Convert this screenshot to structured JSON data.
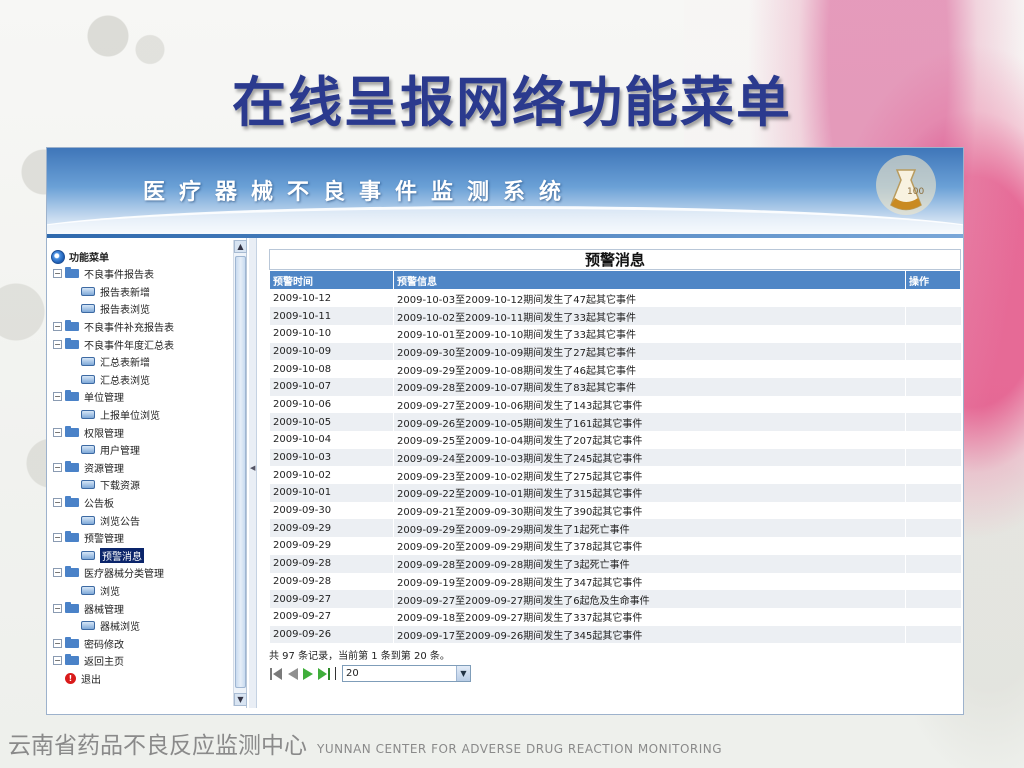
{
  "slide": {
    "title": "在线呈报网络功能菜单"
  },
  "banner": {
    "system_title": "医疗器械不良事件监测系统"
  },
  "sidebar": {
    "root_label": "功能菜单",
    "items": [
      {
        "level": 1,
        "type": "folder",
        "label": "不良事件报告表"
      },
      {
        "level": 2,
        "type": "page",
        "label": "报告表新增"
      },
      {
        "level": 2,
        "type": "page",
        "label": "报告表浏览"
      },
      {
        "level": 1,
        "type": "folder",
        "label": "不良事件补充报告表"
      },
      {
        "level": 1,
        "type": "folder",
        "label": "不良事件年度汇总表"
      },
      {
        "level": 2,
        "type": "page",
        "label": "汇总表新增"
      },
      {
        "level": 2,
        "type": "page",
        "label": "汇总表浏览"
      },
      {
        "level": 1,
        "type": "folder",
        "label": "单位管理"
      },
      {
        "level": 2,
        "type": "page",
        "label": "上报单位浏览"
      },
      {
        "level": 1,
        "type": "folder",
        "label": "权限管理"
      },
      {
        "level": 2,
        "type": "page",
        "label": "用户管理"
      },
      {
        "level": 1,
        "type": "folder",
        "label": "资源管理"
      },
      {
        "level": 2,
        "type": "page",
        "label": "下载资源"
      },
      {
        "level": 1,
        "type": "folder",
        "label": "公告板"
      },
      {
        "level": 2,
        "type": "page",
        "label": "浏览公告"
      },
      {
        "level": 1,
        "type": "folder",
        "label": "预警管理"
      },
      {
        "level": 2,
        "type": "page",
        "label": "预警消息",
        "selected": true
      },
      {
        "level": 1,
        "type": "folder",
        "label": "医疗器械分类管理"
      },
      {
        "level": 2,
        "type": "page",
        "label": "浏览"
      },
      {
        "level": 1,
        "type": "folder",
        "label": "器械管理"
      },
      {
        "level": 2,
        "type": "page",
        "label": "器械浏览"
      },
      {
        "level": 1,
        "type": "folder",
        "label": "密码修改"
      },
      {
        "level": 1,
        "type": "folder",
        "label": "返回主页"
      },
      {
        "level": 1,
        "type": "exit",
        "label": "退出"
      }
    ]
  },
  "panel": {
    "title": "预警消息",
    "columns": [
      "预警时间",
      "预警信息",
      "操作"
    ],
    "rows": [
      [
        "2009-10-12",
        "2009-10-03至2009-10-12期间发生了47起其它事件"
      ],
      [
        "2009-10-11",
        "2009-10-02至2009-10-11期间发生了33起其它事件"
      ],
      [
        "2009-10-10",
        "2009-10-01至2009-10-10期间发生了33起其它事件"
      ],
      [
        "2009-10-09",
        "2009-09-30至2009-10-09期间发生了27起其它事件"
      ],
      [
        "2009-10-08",
        "2009-09-29至2009-10-08期间发生了46起其它事件"
      ],
      [
        "2009-10-07",
        "2009-09-28至2009-10-07期间发生了83起其它事件"
      ],
      [
        "2009-10-06",
        "2009-09-27至2009-10-06期间发生了143起其它事件"
      ],
      [
        "2009-10-05",
        "2009-09-26至2009-10-05期间发生了161起其它事件"
      ],
      [
        "2009-10-04",
        "2009-09-25至2009-10-04期间发生了207起其它事件"
      ],
      [
        "2009-10-03",
        "2009-09-24至2009-10-03期间发生了245起其它事件"
      ],
      [
        "2009-10-02",
        "2009-09-23至2009-10-02期间发生了275起其它事件"
      ],
      [
        "2009-10-01",
        "2009-09-22至2009-10-01期间发生了315起其它事件"
      ],
      [
        "2009-09-30",
        "2009-09-21至2009-09-30期间发生了390起其它事件"
      ],
      [
        "2009-09-29",
        "2009-09-29至2009-09-29期间发生了1起死亡事件"
      ],
      [
        "2009-09-29",
        "2009-09-20至2009-09-29期间发生了378起其它事件"
      ],
      [
        "2009-09-28",
        "2009-09-28至2009-09-28期间发生了3起死亡事件"
      ],
      [
        "2009-09-28",
        "2009-09-19至2009-09-28期间发生了347起其它事件"
      ],
      [
        "2009-09-27",
        "2009-09-27至2009-09-27期间发生了6起危及生命事件"
      ],
      [
        "2009-09-27",
        "2009-09-18至2009-09-27期间发生了337起其它事件"
      ],
      [
        "2009-09-26",
        "2009-09-17至2009-09-26期间发生了345起其它事件"
      ]
    ],
    "summary": "共 97 条记录，当前第 1 条到第 20 条。",
    "page_size": "20"
  },
  "footer": {
    "org_cn": "云南省药品不良反应监测中心",
    "org_en": "YUNNAN CENTER FOR ADVERSE DRUG REACTION MONITORING"
  },
  "colors": {
    "title": "#2b3a8e",
    "header_blue": "#4f86c6",
    "row_alt": "#eceff3",
    "selected": "#0a246a"
  }
}
